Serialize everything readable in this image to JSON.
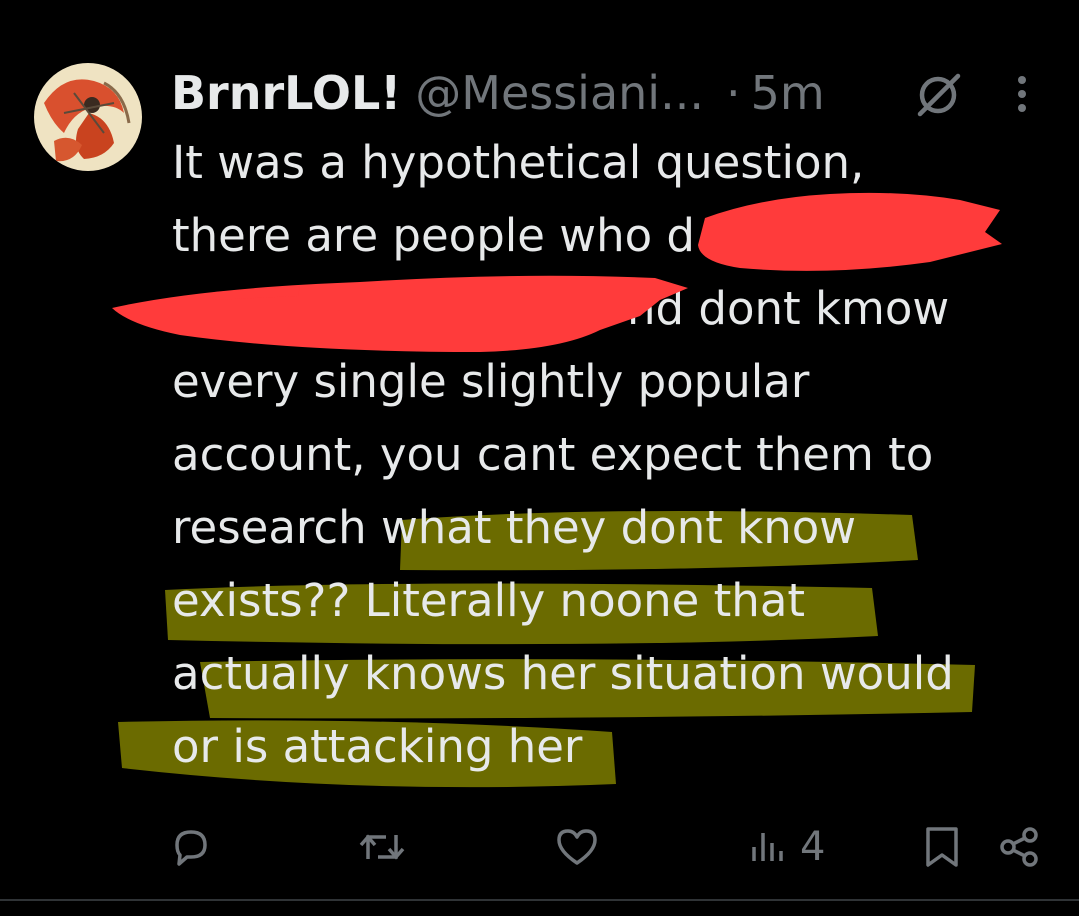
{
  "tweet": {
    "author": {
      "display_name": "BrnrLOL!",
      "handle": "@Messiani...",
      "avatar_icon": "painted-portrait-avatar"
    },
    "separator": "·",
    "timestamp": "5m",
    "body_lines": [
      "It was a hypothetical question,",
      "there are people who d",
      "",
      "every single slightly popular",
      "account, you cant expect them to",
      "research what they dont know",
      "exists?? Literally noone that",
      "actually knows her situation would",
      "or is attacking her"
    ],
    "partial_line_tail": "nd dont kmow",
    "highlighted_text": "what they dont know exists?? Literally noone that actually knows her situation would or is attacking her",
    "annotations": {
      "redaction_color": "#ff3b3b",
      "highlight_color": "#6b6b00"
    },
    "actions": {
      "reply_icon": "reply-icon",
      "repost_icon": "repost-icon",
      "like_icon": "heart-icon",
      "views_icon": "views-icon",
      "views_count": "4",
      "bookmark_icon": "bookmark-icon",
      "share_icon": "share-icon"
    },
    "header_icons": [
      "grok-icon",
      "more-icon"
    ]
  }
}
